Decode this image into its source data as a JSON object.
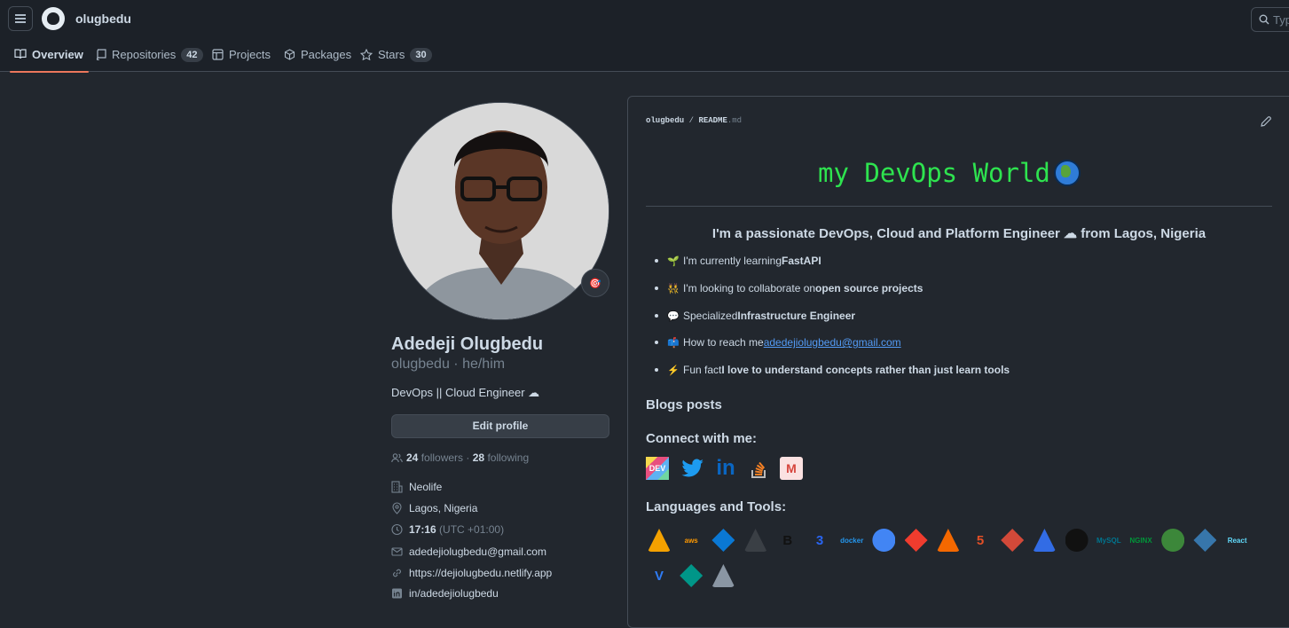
{
  "header": {
    "username": "olugbedu",
    "search_placeholder": "Typ"
  },
  "tabs": [
    {
      "label": "Overview",
      "count": ""
    },
    {
      "label": "Repositories",
      "count": "42"
    },
    {
      "label": "Projects",
      "count": ""
    },
    {
      "label": "Packages",
      "count": ""
    },
    {
      "label": "Stars",
      "count": "30"
    }
  ],
  "profile": {
    "full_name": "Adedeji Olugbedu",
    "login_line": "olugbedu · he/him",
    "bio": "DevOps || Cloud Engineer ☁",
    "edit_label": "Edit profile",
    "followers_count": "24",
    "followers_label": "followers",
    "separator": "·",
    "following_count": "28",
    "following_label": "following",
    "company": "Neolife",
    "location": "Lagos, Nigeria",
    "time": "17:16",
    "timezone": "(UTC +01:00)",
    "email": "adedejiolugbedu@gmail.com",
    "website": "https://dejiolugbedu.netlify.app",
    "linkedin": "in/adedejiolugbedu"
  },
  "readme": {
    "owner": "olugbedu",
    "slash": "/",
    "file": "README",
    "ext": ".md",
    "title": "my DevOps World",
    "intro": "I'm a passionate DevOps, Cloud and Platform Engineer ☁ from Lagos, Nigeria",
    "bullets": [
      {
        "emoji": "🌱",
        "pre": "I'm currently learning ",
        "bold": "FastAPI",
        "link": "",
        "post": ""
      },
      {
        "emoji": "👯",
        "pre": "I'm looking to collaborate on ",
        "bold": "open source projects",
        "link": "",
        "post": ""
      },
      {
        "emoji": "💬",
        "pre": "Specialized ",
        "bold": "Infrastructure Engineer",
        "link": "",
        "post": ""
      },
      {
        "emoji": "📫",
        "pre": "How to reach me ",
        "bold": "",
        "link": "adedejiolugbedu@gmail.com",
        "post": ""
      },
      {
        "emoji": "⚡",
        "pre": "Fun fact ",
        "bold": "I love to understand concepts rather than just learn tools",
        "link": "",
        "post": ""
      }
    ],
    "blogs_heading": "Blogs posts",
    "connect_heading": "Connect with me:",
    "languages_heading": "Languages and Tools:",
    "social": [
      {
        "icon": "dev-icon",
        "text": "DEV"
      },
      {
        "icon": "twitter-icon",
        "text": ""
      },
      {
        "icon": "linkedin-icon",
        "text": "in"
      },
      {
        "icon": "stackoverflow-icon",
        "text": ""
      },
      {
        "icon": "medium-icon",
        "text": "M"
      }
    ],
    "tools": [
      {
        "icon": "amplify-icon",
        "text": "",
        "color": "#f4a100"
      },
      {
        "icon": "aws-icon",
        "text": "aws",
        "color": "#ff9900"
      },
      {
        "icon": "azure-icon",
        "text": "",
        "color": "#0a78d4"
      },
      {
        "icon": "bash-icon",
        "text": "",
        "color": "#3a3f45"
      },
      {
        "icon": "bootstrap-icon",
        "text": "B",
        "color": "#111111"
      },
      {
        "icon": "css3-icon",
        "text": "3",
        "color": "#2965f1"
      },
      {
        "icon": "docker-icon",
        "text": "docker",
        "color": "#2496ed"
      },
      {
        "icon": "gcp-icon",
        "text": "",
        "color": "#4285f4"
      },
      {
        "icon": "git-icon",
        "text": "",
        "color": "#f03c2e"
      },
      {
        "icon": "grafana-icon",
        "text": "",
        "color": "#f46800"
      },
      {
        "icon": "html5-icon",
        "text": "5",
        "color": "#e34f26"
      },
      {
        "icon": "jenkins-icon",
        "text": "",
        "color": "#d24939"
      },
      {
        "icon": "kubernetes-icon",
        "text": "",
        "color": "#326ce5"
      },
      {
        "icon": "linux-icon",
        "text": "",
        "color": "#111111"
      },
      {
        "icon": "mysql-icon",
        "text": "MySQL",
        "color": "#00758f"
      },
      {
        "icon": "nginx-icon",
        "text": "NGINX",
        "color": "#009639"
      },
      {
        "icon": "nodejs-icon",
        "text": "",
        "color": "#3c873a"
      },
      {
        "icon": "python-icon",
        "text": "",
        "color": "#3776ab"
      },
      {
        "icon": "react-icon",
        "text": "React",
        "color": "#61dafb"
      },
      {
        "icon": "vite-icon",
        "text": "V",
        "color": "#2f7cf6"
      },
      {
        "icon": "fastapi-icon",
        "text": "",
        "color": "#009688"
      },
      {
        "icon": "vscode-icon",
        "text": "",
        "color": "#8a96a3"
      }
    ]
  }
}
